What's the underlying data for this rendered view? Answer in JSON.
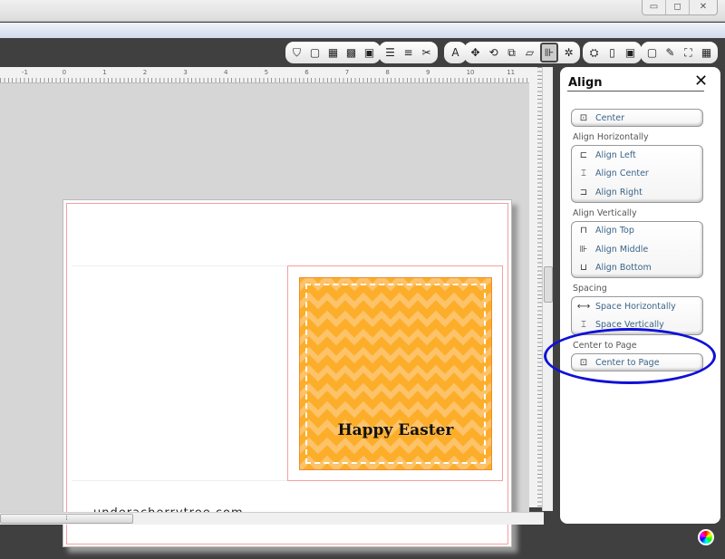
{
  "window": {
    "controls": [
      "minimize-icon",
      "restore-icon",
      "close-icon"
    ],
    "minimize": "▭",
    "restore": "◻",
    "close": "✕"
  },
  "toolbar": {
    "groups": [
      [
        {
          "icon": "fill-icon",
          "g": "⛉"
        },
        {
          "icon": "blank-box-icon",
          "g": "▢"
        },
        {
          "icon": "dotted-pattern-icon",
          "g": "▦"
        },
        {
          "icon": "dark-pattern-icon",
          "g": "▩"
        },
        {
          "icon": "red-grid-icon",
          "g": "▣"
        }
      ],
      [
        {
          "icon": "line-colors-icon",
          "g": "☰"
        },
        {
          "icon": "line-styles-icon",
          "g": "≡"
        },
        {
          "icon": "scissors-cut-icon",
          "g": "✂"
        }
      ],
      [
        {
          "icon": "text-icon",
          "g": "A"
        }
      ],
      [
        {
          "icon": "move-icon",
          "g": "✥"
        },
        {
          "icon": "rotate-icon",
          "g": "⟲"
        },
        {
          "icon": "resize-icon",
          "g": "⧉"
        },
        {
          "icon": "slant-icon",
          "g": "▱"
        },
        {
          "icon": "align-icon",
          "g": "⊪",
          "selected": true
        },
        {
          "icon": "settings-icon",
          "g": "✲"
        }
      ],
      [
        {
          "icon": "image-icon",
          "g": "⛭"
        },
        {
          "icon": "page-icon",
          "g": "▯"
        },
        {
          "icon": "layer-icon",
          "g": "▣"
        }
      ],
      [
        {
          "icon": "border-icon",
          "g": "▢"
        },
        {
          "icon": "pencil-icon",
          "g": "✎"
        },
        {
          "icon": "fullscreen-icon",
          "g": "⛶"
        },
        {
          "icon": "grid-icon",
          "g": "▦"
        }
      ]
    ]
  },
  "ruler": {
    "ticks": [
      "-1",
      "0",
      "1",
      "2",
      "3",
      "4",
      "5",
      "6",
      "7",
      "8",
      "9",
      "10",
      "11"
    ]
  },
  "card": {
    "greeting": "Happy Easter",
    "website": "underacherrytree.com",
    "colors": {
      "orange": "#fcae2a",
      "border": "#f4a0a0"
    }
  },
  "panel": {
    "title": "Align",
    "close": "✕",
    "center": {
      "label": "Center",
      "icon": "center-icon"
    },
    "sections": [
      {
        "title": "Align Horizontally",
        "items": [
          {
            "label": "Align Left",
            "icon": "align-left-icon",
            "g": "⊏"
          },
          {
            "label": "Align Center",
            "icon": "align-center-icon",
            "g": "⌶"
          },
          {
            "label": "Align Right",
            "icon": "align-right-icon",
            "g": "⊐"
          }
        ]
      },
      {
        "title": "Align Vertically",
        "items": [
          {
            "label": "Align Top",
            "icon": "align-top-icon",
            "g": "⊓"
          },
          {
            "label": "Align Middle",
            "icon": "align-middle-icon",
            "g": "⊪"
          },
          {
            "label": "Align Bottom",
            "icon": "align-bottom-icon",
            "g": "⊔"
          }
        ]
      },
      {
        "title": "Spacing",
        "items": [
          {
            "label": "Space Horizontally",
            "icon": "space-horizontally-icon",
            "g": "⟷"
          },
          {
            "label": "Space Vertically",
            "icon": "space-vertically-icon",
            "g": "⌶"
          }
        ]
      },
      {
        "title": "Center to Page",
        "items": [
          {
            "label": "Center to Page",
            "icon": "center-to-page-icon",
            "g": "⊡"
          }
        ]
      }
    ],
    "highlight_color": "#1010d8"
  }
}
